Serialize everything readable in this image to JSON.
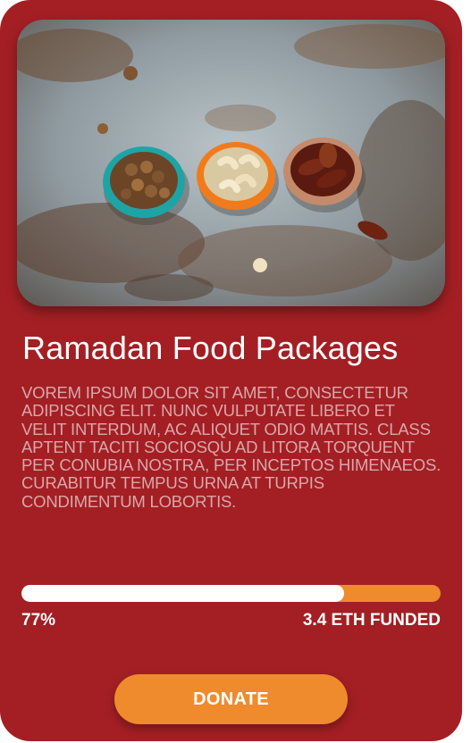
{
  "card": {
    "title": "Ramadan Food Packages",
    "description": "VOREM IPSUM DOLOR SIT AMET, CONSECTETUR ADIPISCING ELIT. NUNC VULPUTATE LIBERO ET VELIT INTERDUM, AC ALIQUET ODIO MATTIS. CLASS APTENT TACITI SOCIOSQU AD LITORA TORQUENT PER CONUBIA NOSTRA, PER INCEPTOS HIMENAEOS. CURABITUR TEMPUS URNA AT TURPIS CONDIMENTUM LOBORTIS.",
    "progress": {
      "fraction": 0.77,
      "percent_label": "77%",
      "funded_label": "3.4 ETH FUNDED"
    },
    "donate_label": "DONATE"
  },
  "colors": {
    "card_background": "#a31f24",
    "accent_orange": "#ef8b2c",
    "progress_fill": "#ffffff",
    "text_primary": "#ffffff",
    "text_muted": "#d9a7a9"
  },
  "icons": {
    "photo": "food-bowls-image"
  }
}
